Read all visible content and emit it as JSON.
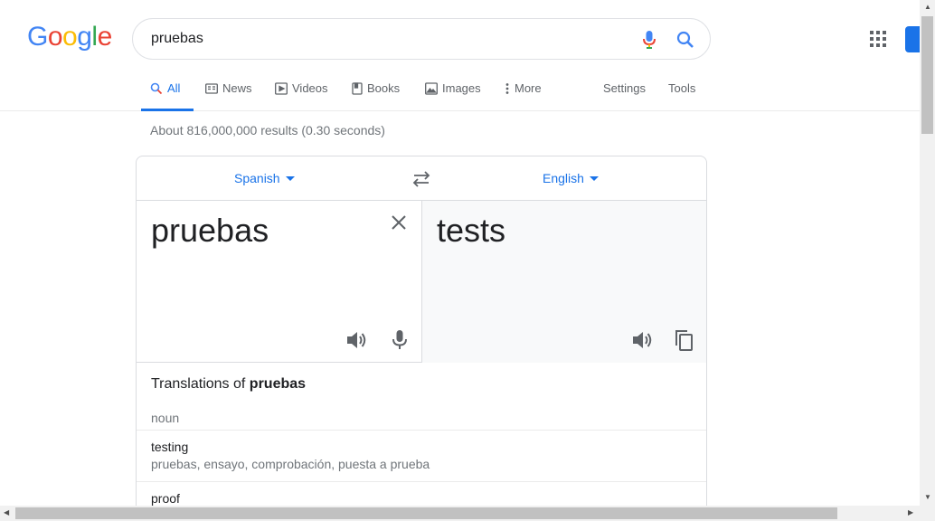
{
  "logo": {
    "letters": [
      "G",
      "o",
      "o",
      "g",
      "l",
      "e"
    ],
    "colors": [
      "#4285F4",
      "#EA4335",
      "#FBBC05",
      "#4285F4",
      "#34A853",
      "#EA4335"
    ]
  },
  "search": {
    "value": "pruebas",
    "placeholder": ""
  },
  "tabs": [
    {
      "label": "All",
      "icon": "search-icon",
      "active": true
    },
    {
      "label": "News",
      "icon": "news-icon"
    },
    {
      "label": "Videos",
      "icon": "play-icon"
    },
    {
      "label": "Books",
      "icon": "book-icon"
    },
    {
      "label": "Images",
      "icon": "image-icon"
    },
    {
      "label": "More",
      "icon": "more-vert-icon"
    },
    {
      "label": "Settings"
    },
    {
      "label": "Tools"
    }
  ],
  "result_stats": "About 816,000,000 results (0.30 seconds)",
  "translate": {
    "source_lang": "Spanish",
    "target_lang": "English",
    "source_text": "pruebas",
    "target_text": "tests",
    "translations_prefix": "Translations of ",
    "translations_word": "pruebas",
    "part_of_speech": "noun",
    "entries": [
      {
        "word": "testing",
        "synonyms": "pruebas, ensayo, comprobación, puesta a prueba"
      },
      {
        "word": "proof",
        "synonyms": ""
      }
    ]
  },
  "colors": {
    "accent": "#1a73e8",
    "muted": "#70757a",
    "border": "#dadce0"
  }
}
